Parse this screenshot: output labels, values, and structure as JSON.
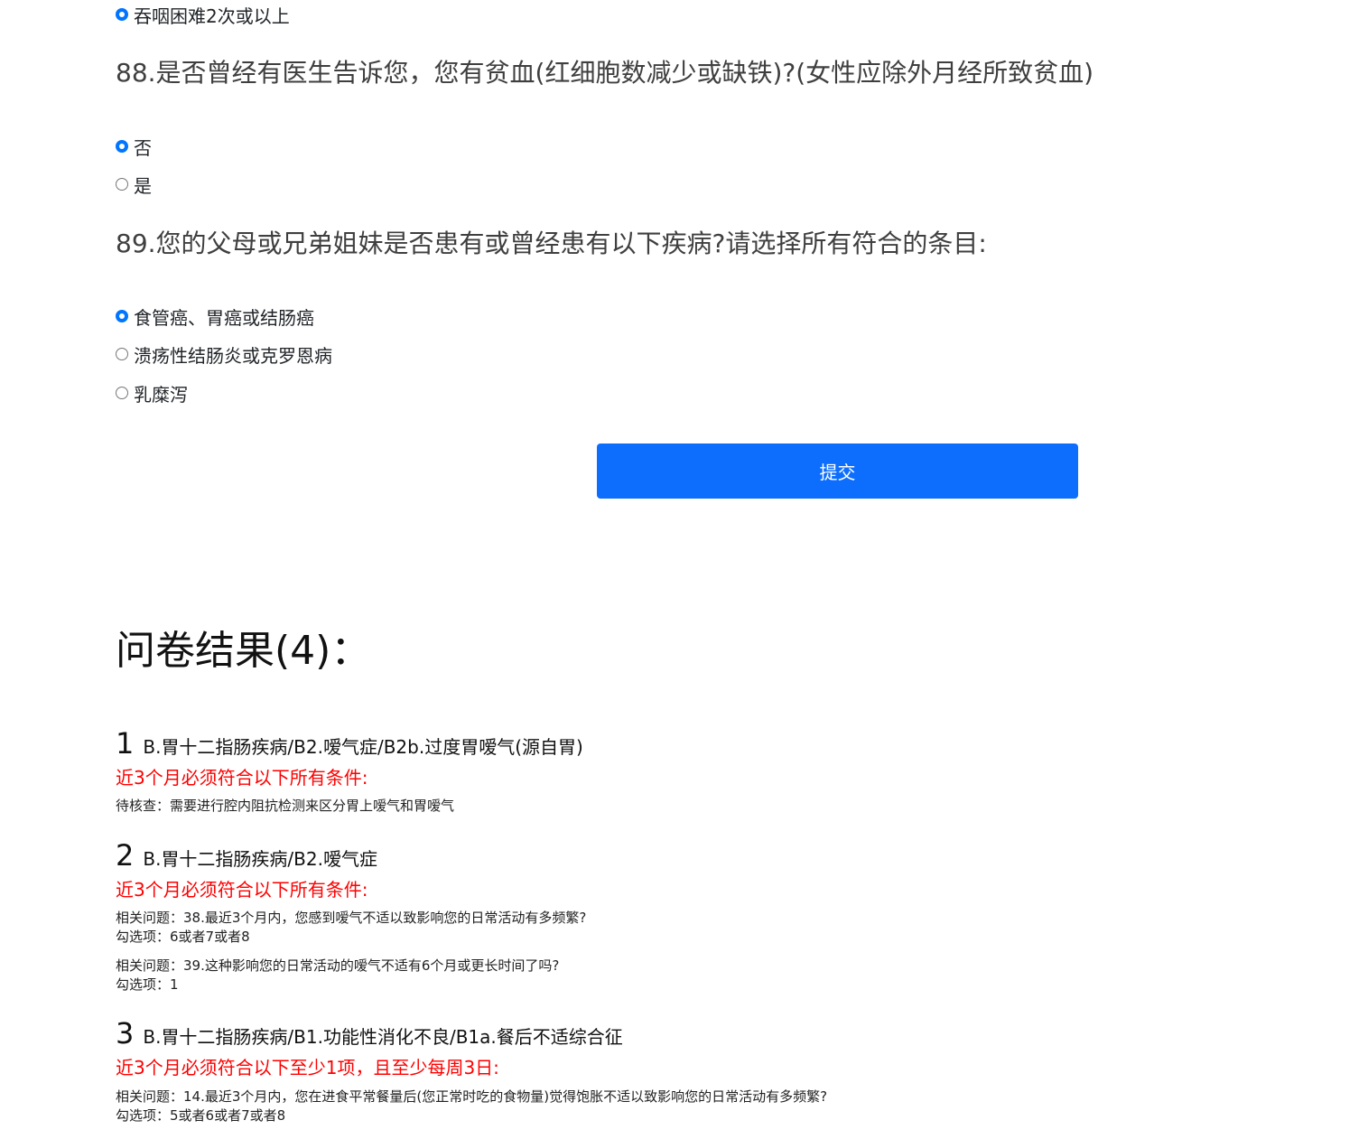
{
  "prev_question": {
    "options": [
      {
        "label": "吞咽困难2次或以上",
        "checked": true
      }
    ]
  },
  "q88": {
    "title": "88.是否曾经有医生告诉您，您有贫血(红细胞数减少或缺铁)?(女性应除外月经所致贫血)",
    "options": [
      {
        "label": "否",
        "checked": true
      },
      {
        "label": "是",
        "checked": false
      }
    ]
  },
  "q89": {
    "title": "89.您的父母或兄弟姐妹是否患有或曾经患有以下疾病?请选择所有符合的条目:",
    "options": [
      {
        "label": "食管癌、胃癌或结肠癌",
        "checked": true
      },
      {
        "label": "溃疡性结肠炎或克罗恩病",
        "checked": false
      },
      {
        "label": "乳糜泻",
        "checked": false
      }
    ]
  },
  "submit_label": "提交",
  "results": {
    "title": "问卷结果(4)：",
    "items": [
      {
        "num": "1",
        "name": "B.胃十二指肠疾病/B2.嗳气症/B2b.过度胃嗳气(源自胃)",
        "condition": "近3个月必须符合以下所有条件:",
        "lines": [
          "待核查：需要进行腔内阻抗检测来区分胃上嗳气和胃嗳气"
        ]
      },
      {
        "num": "2",
        "name": "B.胃十二指肠疾病/B2.嗳气症",
        "condition": "近3个月必须符合以下所有条件:",
        "lines": [
          "相关问题：38.最近3个月内，您感到嗳气不适以致影响您的日常活动有多频繁?",
          "勾选项：6或者7或者8",
          "相关问题：39.这种影响您的日常活动的嗳气不适有6个月或更长时间了吗?",
          "勾选项：1"
        ]
      },
      {
        "num": "3",
        "name": "B.胃十二指肠疾病/B1.功能性消化不良/B1a.餐后不适综合征",
        "condition": "近3个月必须符合以下至少1项，且至少每周3日:",
        "lines": [
          "相关问题：14.最近3个月内，您在进食平常餐量后(您正常时吃的食物量)觉得饱胀不适以致影响您的日常活动有多频繁?",
          "勾选项：5或者6或者7或者8"
        ]
      }
    ]
  }
}
